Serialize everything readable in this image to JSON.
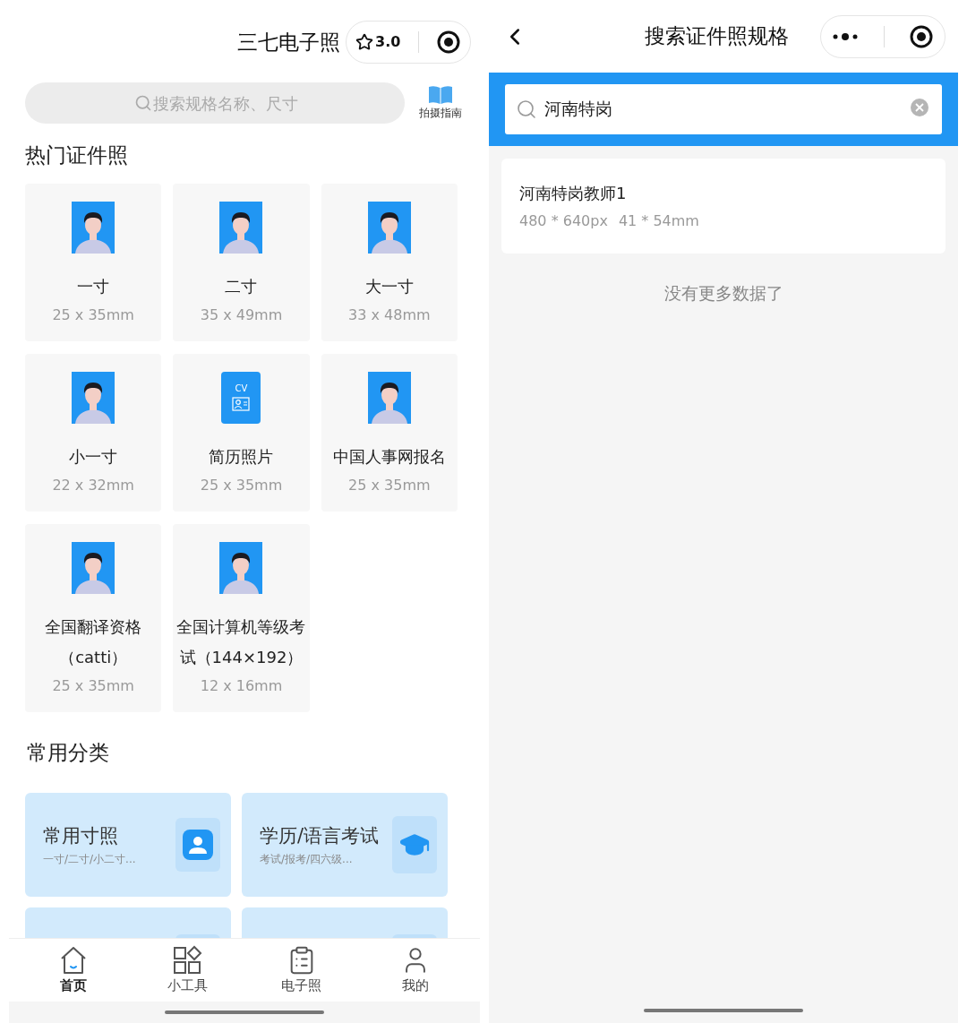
{
  "home": {
    "title": "三七电子照",
    "rating": "3.0",
    "search": {
      "placeholder": "搜索规格名称、尺寸"
    },
    "guide_label": "拍摄指南",
    "hot_heading": "热门证件照",
    "specs": [
      {
        "kind": "photo",
        "name": "一寸",
        "size": "25 x 35mm"
      },
      {
        "kind": "photo",
        "name": "二寸",
        "size": "35 x 49mm"
      },
      {
        "kind": "photo",
        "name": "大一寸",
        "size": "33 x 48mm"
      },
      {
        "kind": "photo",
        "name": "小一寸",
        "size": "22 x 32mm"
      },
      {
        "kind": "cv",
        "badge": "CV",
        "name": "简历照片",
        "size": "25 x 35mm"
      },
      {
        "kind": "photo",
        "name": "中国人事网报名",
        "size": "25 x 35mm"
      },
      {
        "kind": "photo",
        "name": "全国翻译资格（catti）",
        "size": "25 x 35mm"
      },
      {
        "kind": "photo",
        "name": "全国计算机等级考试（144×192）",
        "size": "12 x 16mm"
      }
    ],
    "category_heading": "常用分类",
    "categories": [
      {
        "kind": "person",
        "title": "常用寸照",
        "subtitle": "一寸/二寸/小二寸..."
      },
      {
        "kind": "cap",
        "title": "学历/语言考试",
        "subtitle": "考试/报考/四六级..."
      },
      {
        "kind": "partial"
      },
      {
        "kind": "partial"
      }
    ],
    "tabs": [
      {
        "kind": "home",
        "label": "首页",
        "selected": true
      },
      {
        "kind": "tools",
        "label": "小工具",
        "selected": false
      },
      {
        "kind": "clipboard",
        "label": "电子照",
        "selected": false
      },
      {
        "kind": "user",
        "label": "我的",
        "selected": false
      }
    ]
  },
  "search_page": {
    "title": "搜索证件照规格",
    "search": {
      "value": "河南特岗"
    },
    "results": [
      {
        "name": "河南特岗教师1",
        "pixels": "480 * 640px",
        "mm": "41 * 54mm"
      }
    ],
    "end_note": "没有更多数据了"
  }
}
